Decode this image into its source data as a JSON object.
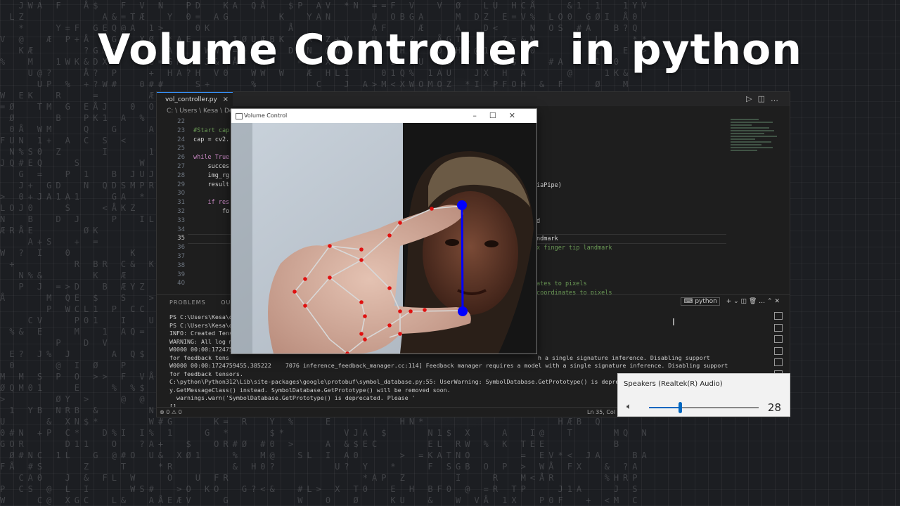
{
  "headline": "Volume Controller  in python",
  "editor": {
    "tab_label": "vol_controller.py",
    "tab_close": "×",
    "breadcrumb": "C: \\ Users \\ Kesa \\ De",
    "line_numbers": [
      "22",
      "23",
      "24",
      "25",
      "26",
      "27",
      "28",
      "29",
      "30",
      "31",
      "32",
      "33",
      "34",
      "35",
      "36",
      "37",
      "38",
      "39",
      "40"
    ],
    "active_line": "35",
    "code_lines": [
      "",
      "#Start cap",
      "cap = cv2.",
      "",
      "while True",
      "    succes",
      "    img_rg",
      "    result",
      "",
      "    if res",
      "        fo",
      "",
      "",
      "",
      "",
      "",
      "",
      "",
      ""
    ],
    "code_fragments_right": [
      {
        "line": 29,
        "text": "iaPipe)"
      },
      {
        "line": 33,
        "text": "d"
      },
      {
        "line": 35,
        "text": "ndmark"
      },
      {
        "line": 36,
        "text": "x finger tip landmark"
      },
      {
        "line": 40,
        "text": "ates to pixels"
      },
      {
        "line": 41,
        "text": "coordinates to pixels"
      }
    ]
  },
  "panel": {
    "tabs": [
      "PROBLEMS",
      "OUTPUT"
    ],
    "terminal_name": "python",
    "terminal_lines": [
      "PS C:\\Users\\Kesa\\d",
      "PS C:\\Users\\Kesa\\d",
      "INFO: Created Tens",
      "WARNING: All log m",
      "W0000 00:00:172475",
      "for feedback tens",
      "W0000 00:00:1724759455.385222    7076 inference_feedback_manager.cc:114] Feedback manager requires a model with a single signature inference. Disabling support",
      "for feedback tensors.",
      "C:\\python\\Python312\\Lib\\site-packages\\google\\protobuf\\symbol_database.py:55: UserWarning: SymbolDatabase.GetPrototype() is deprecated.",
      "y.GetMessageClass() instead. SymbolDatabase.GetPrototype() will be removed soon.",
      "  warnings.warn('SymbolDatabase.GetPrototype() is deprecated. Please '",
      "[]"
    ],
    "overlapped_fragment": "h a single signature inference. Disabling support"
  },
  "statusbar": {
    "left": "⊗ 0  ⚠ 0",
    "right": "Ln 35, Col"
  },
  "volume_window": {
    "title": "Volume Control"
  },
  "speakers": {
    "title": "Speakers (Realtek(R) Audio)",
    "value": "28",
    "level_percent": 28,
    "icon": "speaker-icon"
  },
  "colors": {
    "accent_blue": "#0067c0",
    "landmark_red": "#e01010",
    "pinch_line_blue": "#0000ff"
  }
}
